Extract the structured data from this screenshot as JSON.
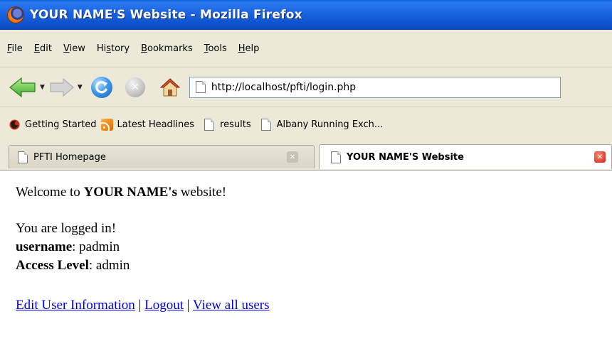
{
  "window": {
    "title": "YOUR NAME'S Website - Mozilla Firefox"
  },
  "menu": {
    "items": [
      "File",
      "Edit",
      "View",
      "History",
      "Bookmarks",
      "Tools",
      "Help"
    ]
  },
  "nav": {
    "url": "http://localhost/pfti/login.php",
    "icons": [
      "back-arrow-icon",
      "forward-arrow-icon",
      "reload-icon",
      "stop-icon",
      "home-icon",
      "page-icon"
    ]
  },
  "bookmarks": {
    "items": [
      "Getting Started",
      "Latest Headlines",
      "results",
      "Albany Running Exch..."
    ]
  },
  "tabs": {
    "items": [
      "PFTI Homepage",
      "YOUR NAME'S Website"
    ]
  },
  "page": {
    "welcome_prefix": "Welcome to ",
    "welcome_name": "YOUR NAME's",
    "welcome_suffix": " website!",
    "logged_in": "You are logged in!",
    "username_label": "username",
    "username_value": ": padmin",
    "access_label": "Access Level",
    "access_value": ": admin",
    "links": [
      "Edit User Information",
      "Logout",
      "View all users"
    ],
    "separator": " | "
  },
  "colors": {
    "titlebar": "#1a63e0",
    "chrome": "#ece9d8",
    "link": "#0000ee"
  }
}
